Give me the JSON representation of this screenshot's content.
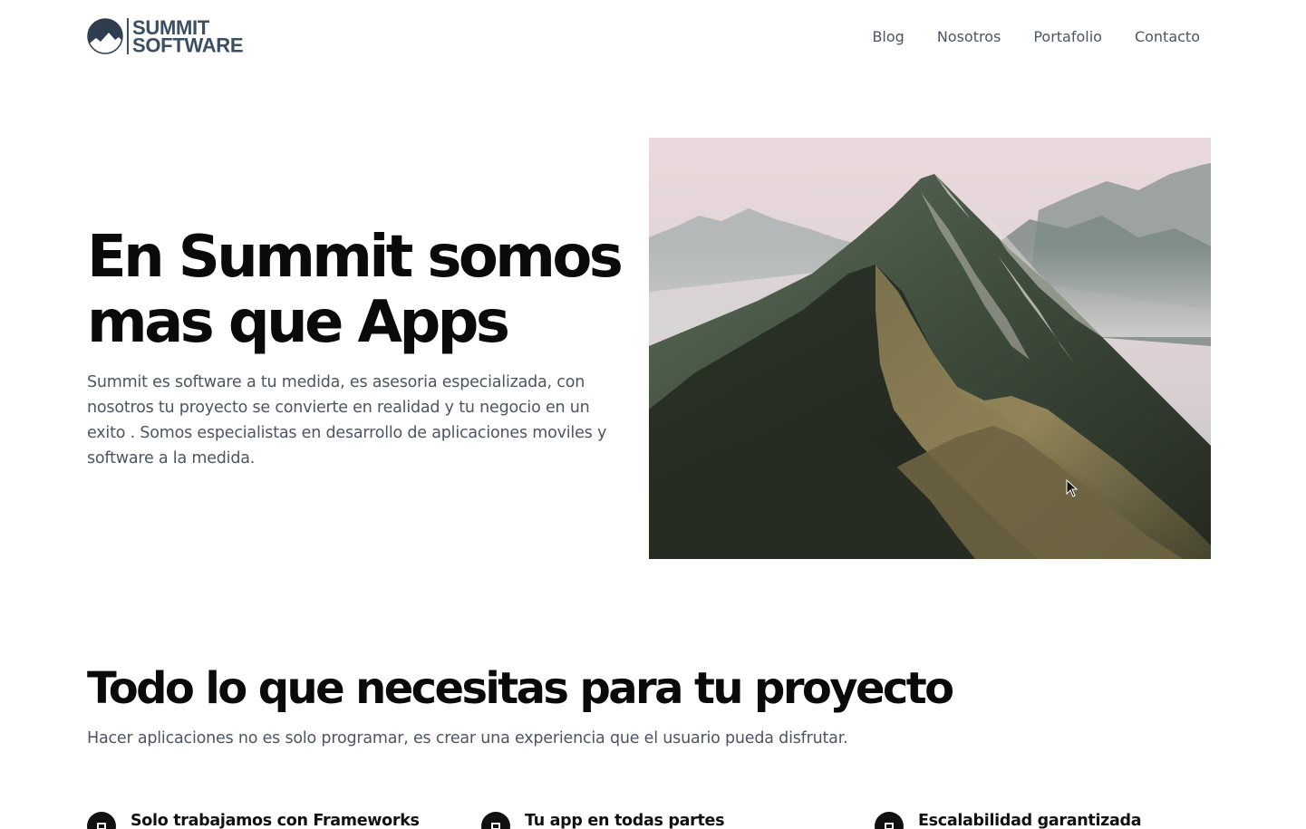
{
  "brand": {
    "line1": "SUMMIT",
    "line2": "SOFTWARE",
    "color": "#3b4e63"
  },
  "nav": {
    "items": [
      {
        "label": "Blog"
      },
      {
        "label": "Nosotros"
      },
      {
        "label": "Portafolio"
      },
      {
        "label": "Contacto"
      }
    ]
  },
  "hero": {
    "title": "En Summit somos mas que Apps",
    "description": "Summit es software a tu medida, es asesoria especializada, con nosotros tu proyecto se convierte en realidad y tu negocio en un exito . Somos especialistas en desarrollo de aplicaciones moviles y software a la medida.",
    "image": "mountain-photo"
  },
  "section": {
    "title": "Todo lo que necesitas para tu proyecto",
    "description": "Hacer aplicaciones no es solo programar, es crear una experiencia que el usuario pueda disfrutar."
  },
  "features": [
    {
      "title": "Solo trabajamos con Frameworks",
      "icon": "briefcase-icon"
    },
    {
      "title": "Tu app en todas partes",
      "icon": "devices-icon"
    },
    {
      "title": "Escalabilidad garantizada",
      "icon": "shield-icon"
    }
  ]
}
